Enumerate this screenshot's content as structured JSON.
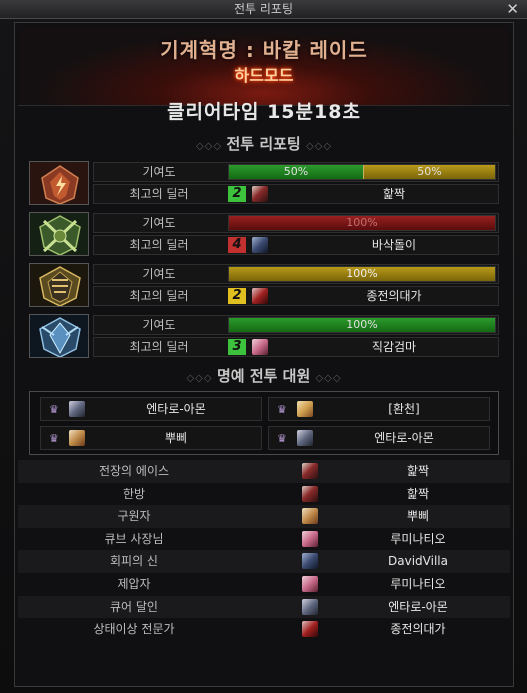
{
  "window": {
    "title": "전투 리포팅",
    "close_glyph": "✕"
  },
  "header": {
    "raid_name": "기계혁명 : 바칼 레이드",
    "mode": "하드모드"
  },
  "clear_time": "클리어타임 15분18초",
  "battle_report": {
    "title": "전투 리포팅",
    "contribution_label": "기여도",
    "best_dealer_label": "최고의 딜러",
    "parties": [
      {
        "emblem": "red-fire-emblem-icon",
        "bars": [
          {
            "label": "50%",
            "value": 50,
            "color": "#2c9a2c"
          },
          {
            "label": "50%",
            "value": 50,
            "color": "#b89a1a"
          }
        ],
        "rank": "2",
        "rank_color": "#3cc23c",
        "dealer": "핥짝"
      },
      {
        "emblem": "green-blade-emblem-icon",
        "bars": [
          {
            "label": "100%",
            "value": 100,
            "color": "#9a2020"
          }
        ],
        "rank": "4",
        "rank_color": "#c23030",
        "dealer": "바삭돌이"
      },
      {
        "emblem": "gold-wing-emblem-icon",
        "bars": [
          {
            "label": "100%",
            "value": 100,
            "color": "#b89a1a"
          }
        ],
        "rank": "2",
        "rank_color": "#e0c020",
        "dealer": "종전의대가"
      },
      {
        "emblem": "blue-crystal-emblem-icon",
        "bars": [
          {
            "label": "100%",
            "value": 100,
            "color": "#2c9a2c"
          }
        ],
        "rank": "3",
        "rank_color": "#3cc23c",
        "dealer": "직감검마"
      }
    ]
  },
  "honor": {
    "title": "명예 전투 대원",
    "members": [
      "엔타로-아몬",
      "[환천]",
      "뿌삐",
      "엔타로-아몬"
    ]
  },
  "awards": [
    {
      "title": "전장의 에이스",
      "name": "핥짝"
    },
    {
      "title": "한방",
      "name": "핥짝"
    },
    {
      "title": "구원자",
      "name": "뿌삐"
    },
    {
      "title": "큐브 사장님",
      "name": "루미나티오"
    },
    {
      "title": "회피의 신",
      "name": "DavidVilla"
    },
    {
      "title": "제압자",
      "name": "루미나티오"
    },
    {
      "title": "큐어 달인",
      "name": "엔타로-아몬"
    },
    {
      "title": "상태이상 전문가",
      "name": "종전의대가"
    }
  ]
}
